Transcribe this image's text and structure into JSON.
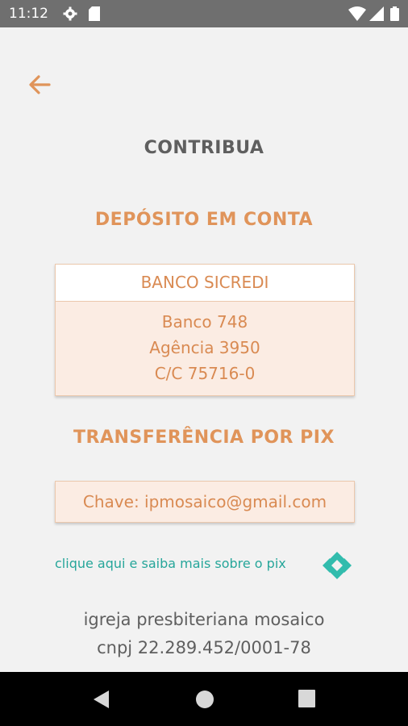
{
  "status_bar": {
    "time": "11:12",
    "icons": [
      "gear-icon",
      "sd-card-icon",
      "wifi-icon",
      "signal-icon",
      "battery-icon"
    ]
  },
  "header": {
    "back_icon": "arrow-left-icon",
    "title": "CONTRIBUA"
  },
  "deposit": {
    "title": "DEPÓSITO EM CONTA",
    "bank_name": "BANCO SICREDI",
    "lines": [
      "Banco 748",
      "Agência 3950",
      "C/C 75716-0"
    ]
  },
  "pix": {
    "title": "TRANSFERÊNCIA POR PIX",
    "key_text": "Chave:  ipmosaico@gmail.com",
    "link_text": "clique aqui e saiba mais sobre o pix",
    "icon": "pix-icon"
  },
  "footer": {
    "name": "igreja presbiteriana mosaico",
    "cnpj": "cnpj 22.289.452/0001-78"
  },
  "nav": {
    "icons": [
      "back-triangle-icon",
      "home-circle-icon",
      "recents-square-icon"
    ]
  },
  "colors": {
    "accent": "#e0945a",
    "card_bg": "#fbece3",
    "link": "#26a69a",
    "title_gray": "#5f5f5f",
    "status_bar": "#6f6f6f"
  }
}
